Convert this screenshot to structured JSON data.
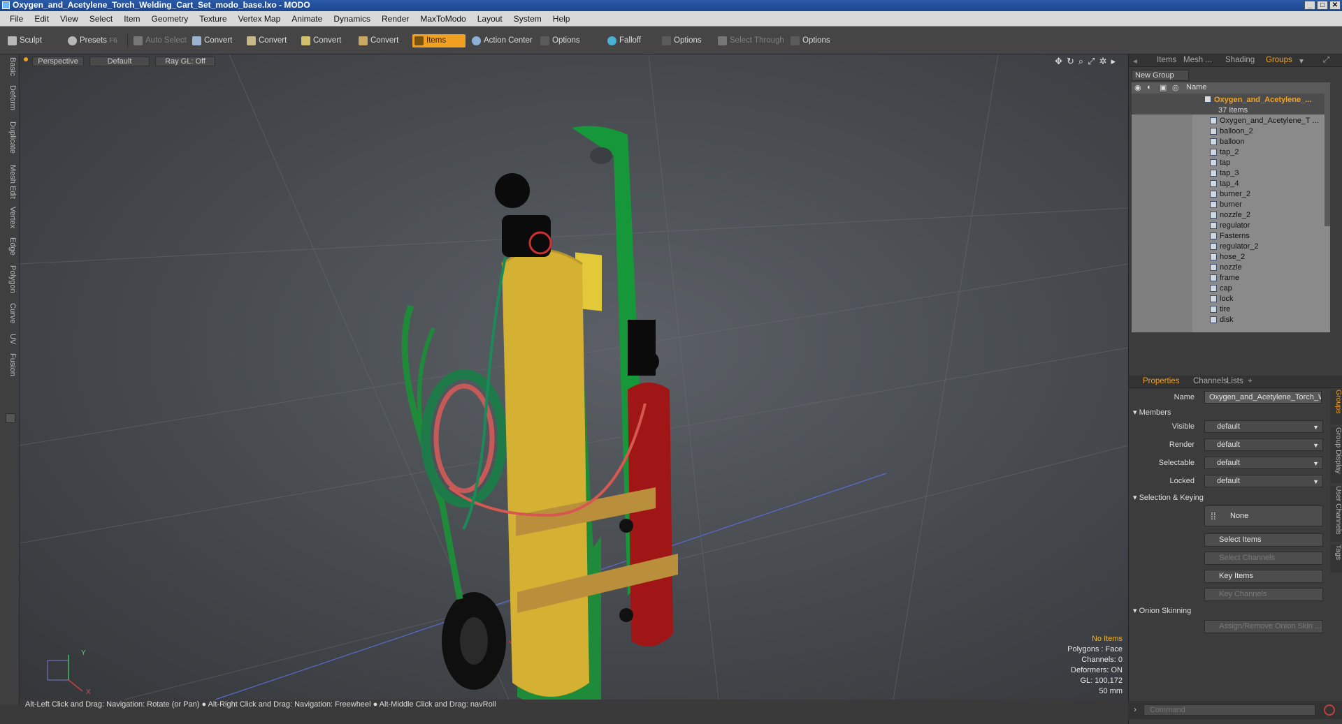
{
  "window": {
    "title": "Oxygen_and_Acetylene_Torch_Welding_Cart_Set_modo_base.lxo - MODO"
  },
  "menu": [
    "File",
    "Edit",
    "View",
    "Select",
    "Item",
    "Geometry",
    "Texture",
    "Vertex Map",
    "Animate",
    "Dynamics",
    "Render",
    "MaxToModo",
    "Layout",
    "System",
    "Help"
  ],
  "toolbar": {
    "sculpt": "Sculpt",
    "presets": "Presets",
    "presets_key": "F6",
    "auto_select": "Auto Select",
    "convert1": "Convert",
    "convert2": "Convert",
    "convert3": "Convert",
    "convert4": "Convert",
    "items": "Items",
    "action_center": "Action Center",
    "options1": "Options",
    "falloff": "Falloff",
    "options2": "Options",
    "select_through": "Select Through",
    "options3": "Options"
  },
  "left_tabs": [
    "Basic",
    "Deform",
    "Duplicate",
    "Mesh Edit",
    "Vertex",
    "Edge",
    "Polygon",
    "Curve",
    "UV",
    "Fusion"
  ],
  "viewport": {
    "perspective": "Perspective",
    "shading": "Default",
    "raygl": "Ray GL: Off"
  },
  "hud": {
    "no_items": "No Items",
    "polygons": "Polygons : Face",
    "channels": "Channels: 0",
    "deformers": "Deformers: ON",
    "gl": "GL: 100,172",
    "focal": "50 mm"
  },
  "status": "Alt-Left Click and Drag: Navigation: Rotate (or Pan) ● Alt-Right Click and Drag: Navigation: Freewheel ● Alt-Middle Click and Drag: navRoll",
  "panel_tabs": {
    "items": "Items",
    "mesh": "Mesh ...",
    "shading": "Shading",
    "groups": "Groups"
  },
  "new_group": "New Group",
  "tree_header": "Name",
  "group": {
    "name": "Oxygen_and_Acetylene_...",
    "count": "37 Items"
  },
  "tree_items": [
    "Oxygen_and_Acetylene_T ...",
    "balloon_2",
    "balloon",
    "tap_2",
    "tap",
    "tap_3",
    "tap_4",
    "burner_2",
    "burner",
    "nozzle_2",
    "regulator",
    "Fasterns",
    "regulator_2",
    "hose_2",
    "nozzle",
    "frame",
    "cap",
    "lock",
    "tire",
    "disk"
  ],
  "props_tabs": {
    "properties": "Properties",
    "channels": "Channels",
    "lists": "Lists",
    "plus": "+"
  },
  "props": {
    "name_label": "Name",
    "name_value": "Oxygen_and_Acetylene_Torch_W",
    "members": "Members",
    "visible": "Visible",
    "render": "Render",
    "selectable": "Selectable",
    "locked": "Locked",
    "default_value": "default",
    "selkey": "Selection & Keying",
    "none": "None",
    "select_items": "Select Items",
    "select_channels": "Select Channels",
    "key_items": "Key Items",
    "key_channels": "Key Channels",
    "onion": "Onion Skinning",
    "assign_onion": "Assign/Remove Onion Skin ..."
  },
  "right_vtabs": [
    "Groups",
    "Group Display",
    "User Channels",
    "Tags"
  ],
  "command_placeholder": "Command"
}
